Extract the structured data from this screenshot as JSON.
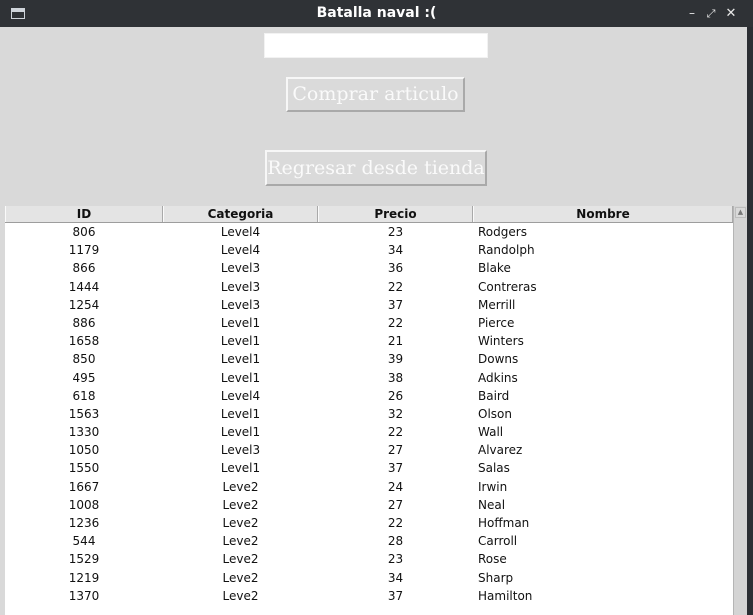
{
  "window": {
    "title": "Batalla naval :(",
    "minimize_glyph": "–",
    "maximize_glyph": "⤢",
    "close_glyph": "✕"
  },
  "search": {
    "value": "",
    "placeholder": ""
  },
  "buttons": {
    "buy_label": "Comprar articulo",
    "back_label": "Regresar desde tienda"
  },
  "table": {
    "headers": [
      "ID",
      "Categoria",
      "Precio",
      "Nombre"
    ],
    "rows": [
      [
        "806",
        "Level4",
        "23",
        "Rodgers"
      ],
      [
        "1179",
        "Level4",
        "34",
        "Randolph"
      ],
      [
        "866",
        "Level3",
        "36",
        "Blake"
      ],
      [
        "1444",
        "Level3",
        "22",
        "Contreras"
      ],
      [
        "1254",
        "Level3",
        "37",
        "Merrill"
      ],
      [
        "886",
        "Level1",
        "22",
        "Pierce"
      ],
      [
        "1658",
        "Level1",
        "21",
        "Winters"
      ],
      [
        "850",
        "Level1",
        "39",
        "Downs"
      ],
      [
        "495",
        "Level1",
        "38",
        "Adkins"
      ],
      [
        "618",
        "Level4",
        "26",
        "Baird"
      ],
      [
        "1563",
        "Level1",
        "32",
        "Olson"
      ],
      [
        "1330",
        "Level1",
        "22",
        "Wall"
      ],
      [
        "1050",
        "Level3",
        "27",
        "Alvarez"
      ],
      [
        "1550",
        "Level1",
        "37",
        "Salas"
      ],
      [
        "1667",
        "Leve2",
        "24",
        "Irwin"
      ],
      [
        "1008",
        "Leve2",
        "27",
        "Neal"
      ],
      [
        "1236",
        "Leve2",
        "22",
        "Hoffman"
      ],
      [
        "544",
        "Leve2",
        "28",
        "Carroll"
      ],
      [
        "1529",
        "Leve2",
        "23",
        "Rose"
      ],
      [
        "1219",
        "Leve2",
        "34",
        "Sharp"
      ],
      [
        "1370",
        "Leve2",
        "37",
        "Hamilton"
      ]
    ]
  },
  "scrollbar": {
    "up_arrow": "▲"
  }
}
